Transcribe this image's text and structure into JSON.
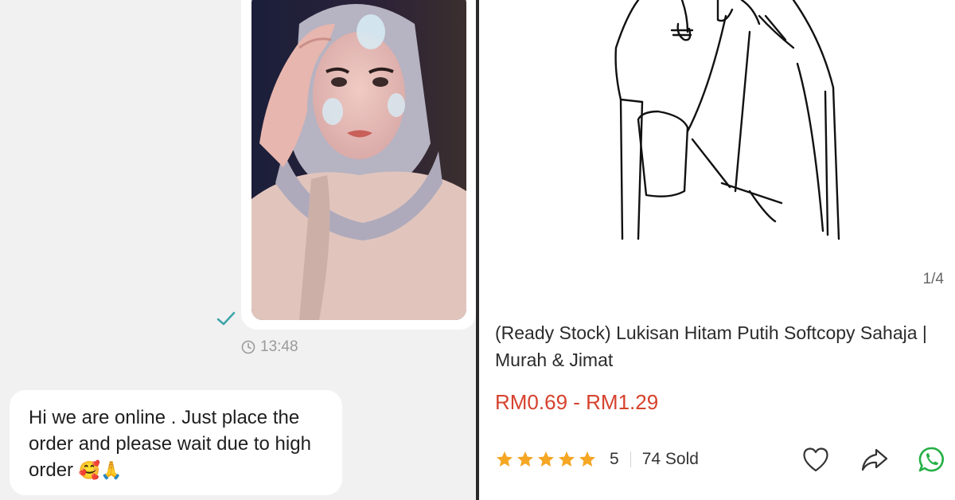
{
  "chat": {
    "timestamp": "13:48",
    "message": "Hi we are online . Just place the order and please wait due to high order",
    "message_emojis": "🥰🙏",
    "check_color": "#3aa5a8"
  },
  "product": {
    "image_counter": "1/4",
    "title": "(Ready Stock) Lukisan Hitam Putih Softcopy Sahaja | Murah & Jimat",
    "price_range": "RM0.69 - RM1.29",
    "price_color": "#d6422d",
    "rating_value": "5",
    "star_color": "#f5a623",
    "sold_count": "74 Sold"
  },
  "icons": {
    "check": "check-icon",
    "clock": "clock-icon",
    "star": "star-icon",
    "heart": "heart-icon",
    "share": "share-icon",
    "whatsapp": "whatsapp-icon"
  }
}
